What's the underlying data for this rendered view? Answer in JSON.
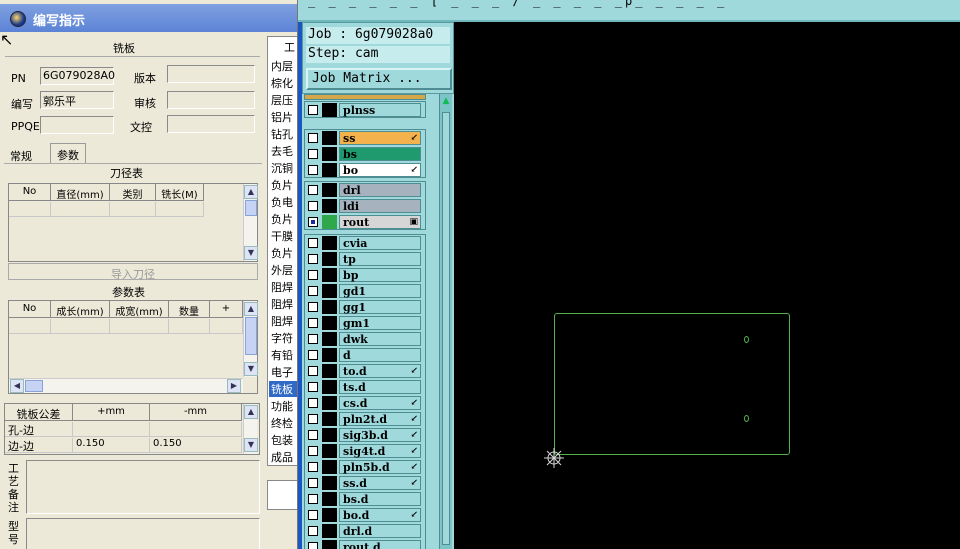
{
  "left_window": {
    "title": "编写指示",
    "section_title": "铣板",
    "fields": {
      "pn_label": "PN",
      "pn_value": "6G079028A0",
      "version_label": "版本",
      "editor_label": "编写",
      "editor_value": "郭乐平",
      "reviewer_label": "审核",
      "ppqe_label": "PPQE",
      "doc_control_label": "文控"
    },
    "tabs": [
      "常规",
      "参数"
    ],
    "tool_table": {
      "title": "刀径表",
      "columns": [
        "No",
        "直径(mm)",
        "类别",
        "铣长(M)"
      ]
    },
    "import_button": "导入刀径",
    "param_table": {
      "title": "参数表",
      "columns": [
        "No",
        "成长(mm)",
        "成宽(mm)",
        "数量",
        "+"
      ]
    },
    "tolerance_table": {
      "columns": [
        "铣板公差",
        "+mm",
        "-mm"
      ],
      "rows": [
        {
          "name": "孔-边",
          "plus": "",
          "minus": ""
        },
        {
          "name": "边-边",
          "plus": "0.150",
          "minus": "0.150"
        }
      ]
    },
    "process_note_label": "工艺备注",
    "model_label": "型号",
    "right_list": {
      "header": "工",
      "items": [
        "内层",
        "棕化",
        "层压",
        "铝片",
        "钻孔",
        "去毛",
        "沉铜",
        "负片",
        "负电",
        "负片",
        "干膜",
        "负片",
        "外层",
        "阻焊",
        "阻焊",
        "阻焊",
        "字符",
        "有铅",
        "电子",
        "铣板",
        "功能",
        "终检",
        "包装",
        "成品"
      ],
      "selected_index": 19
    }
  },
  "cam_window": {
    "title_fragment": "_ _ _ _ _ _  [  _  _ _ /  _ _ _  _ _p_ _ _ _ _",
    "job_label": "Job : 6g079028a0",
    "step_label": "Step: cam",
    "job_matrix_button": "Job Matrix ...",
    "layers": [
      {
        "name": "plnss",
        "color": "#9fd9dc",
        "sw": "#000000",
        "flag": ""
      },
      {
        "name": "ss",
        "color": "#f3b24b",
        "sw": "#000000",
        "flag": "↙"
      },
      {
        "name": "bs",
        "color": "#1e9a6e",
        "sw": "#000000",
        "flag": ""
      },
      {
        "name": "bo",
        "color": "#ffffff",
        "sw": "#000000",
        "flag": "↙"
      },
      {
        "name": "drl",
        "color": "#a6b3be",
        "sw": "#000000",
        "flag": ""
      },
      {
        "name": "ldi",
        "color": "#a6b3be",
        "sw": "#000000",
        "flag": ""
      },
      {
        "name": "rout",
        "color": "#d6d6d6",
        "sw": "#2ea84a",
        "flag": "▣",
        "checked": true
      },
      {
        "name": "cvia",
        "color": "#9fd9dc",
        "sw": "#000000",
        "flag": ""
      },
      {
        "name": "tp",
        "color": "#9fd9dc",
        "sw": "#000000",
        "flag": ""
      },
      {
        "name": "bp",
        "color": "#9fd9dc",
        "sw": "#000000",
        "flag": ""
      },
      {
        "name": "gd1",
        "color": "#9fd9dc",
        "sw": "#000000",
        "flag": ""
      },
      {
        "name": "gg1",
        "color": "#9fd9dc",
        "sw": "#000000",
        "flag": ""
      },
      {
        "name": "gm1",
        "color": "#9fd9dc",
        "sw": "#000000",
        "flag": ""
      },
      {
        "name": "dwk",
        "color": "#9fd9dc",
        "sw": "#000000",
        "flag": ""
      },
      {
        "name": "d",
        "color": "#9fd9dc",
        "sw": "#000000",
        "flag": ""
      },
      {
        "name": "to.d",
        "color": "#9fd9dc",
        "sw": "#000000",
        "flag": "↙"
      },
      {
        "name": "ts.d",
        "color": "#9fd9dc",
        "sw": "#000000",
        "flag": ""
      },
      {
        "name": "cs.d",
        "color": "#9fd9dc",
        "sw": "#000000",
        "flag": "↙"
      },
      {
        "name": "pln2t.d",
        "color": "#9fd9dc",
        "sw": "#000000",
        "flag": "↙"
      },
      {
        "name": "sig3b.d",
        "color": "#9fd9dc",
        "sw": "#000000",
        "flag": "↙"
      },
      {
        "name": "sig4t.d",
        "color": "#9fd9dc",
        "sw": "#000000",
        "flag": "↙"
      },
      {
        "name": "pln5b.d",
        "color": "#9fd9dc",
        "sw": "#000000",
        "flag": "↙"
      },
      {
        "name": "ss.d",
        "color": "#9fd9dc",
        "sw": "#000000",
        "flag": "↙"
      },
      {
        "name": "bs.d",
        "color": "#9fd9dc",
        "sw": "#000000",
        "flag": ""
      },
      {
        "name": "bo.d",
        "color": "#9fd9dc",
        "sw": "#000000",
        "flag": "↙"
      },
      {
        "name": "drl.d",
        "color": "#9fd9dc",
        "sw": "#000000",
        "flag": ""
      },
      {
        "name": "rout.d",
        "color": "#9fd9dc",
        "sw": "#000000",
        "flag": ""
      }
    ],
    "canvas": {
      "board_outline_color": "#4fb24a"
    }
  }
}
